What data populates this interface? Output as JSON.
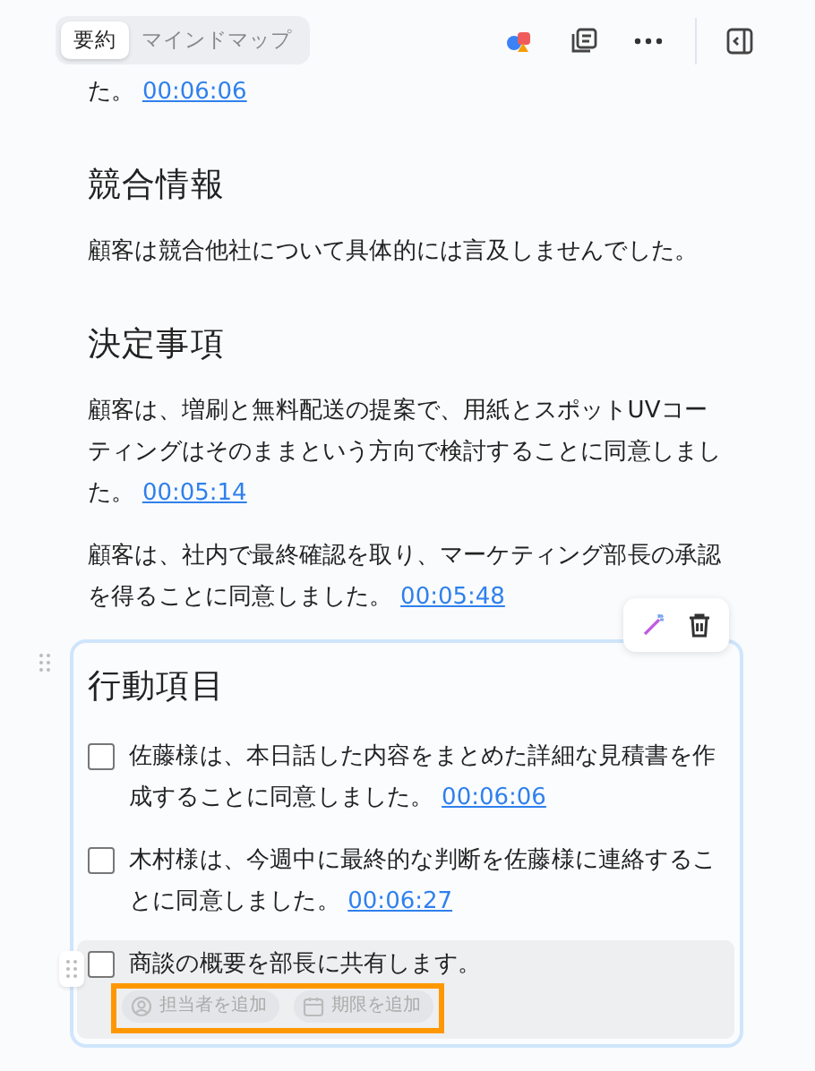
{
  "tabs": [
    {
      "label": "要約",
      "selected": true
    },
    {
      "label": "マインドマップ",
      "selected": false
    }
  ],
  "intro": {
    "text": "た。",
    "timestamp": "00:06:06"
  },
  "sections": [
    {
      "heading": "競合情報",
      "paragraphs": [
        {
          "text": "顧客は競合他社について具体的には言及しませんでした。"
        }
      ]
    },
    {
      "heading": "決定事項",
      "paragraphs": [
        {
          "text": "顧客は、増刷と無料配送の提案で、用紙とスポットUVコーティングはそのままという方向で検討することに同意しました。",
          "timestamp": "00:05:14"
        },
        {
          "text": "顧客は、社内で最終確認を取り、マーケティング部長の承認を得ることに同意しました。",
          "timestamp": "00:05:48"
        }
      ]
    }
  ],
  "action_items": {
    "heading": "行動項目",
    "items": [
      {
        "text": "佐藤様は、本日話した内容をまとめた詳細な見積書を作成することに同意しました。",
        "timestamp": "00:06:06",
        "checked": false,
        "active": false
      },
      {
        "text": "木村様は、今週中に最終的な判断を佐藤様に連絡することに同意しました。",
        "timestamp": "00:06:27",
        "checked": false,
        "active": false
      },
      {
        "text": "商談の概要を部長に共有します。",
        "checked": false,
        "active": true,
        "chips": [
          {
            "kind": "assignee",
            "label": "担当者を追加"
          },
          {
            "kind": "due",
            "label": "期限を追加"
          }
        ]
      }
    ]
  }
}
